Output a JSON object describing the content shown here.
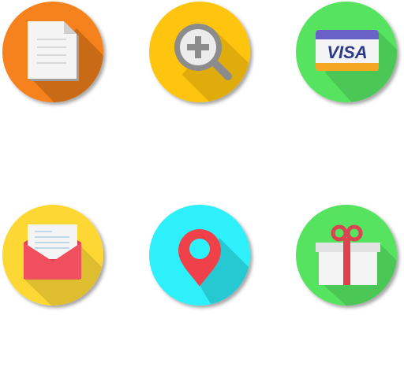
{
  "icons": [
    {
      "name": "document-icon",
      "bg_color": "#F5821F"
    },
    {
      "name": "zoom-in-icon",
      "bg_color": "#FFC40C"
    },
    {
      "name": "credit-card-icon",
      "bg_color": "#55E360",
      "card_text": "VISA"
    },
    {
      "name": "mail-icon",
      "bg_color": "#FDD835"
    },
    {
      "name": "location-pin-icon",
      "bg_color": "#2EF0FA"
    },
    {
      "name": "gift-icon",
      "bg_color": "#55E360"
    }
  ]
}
